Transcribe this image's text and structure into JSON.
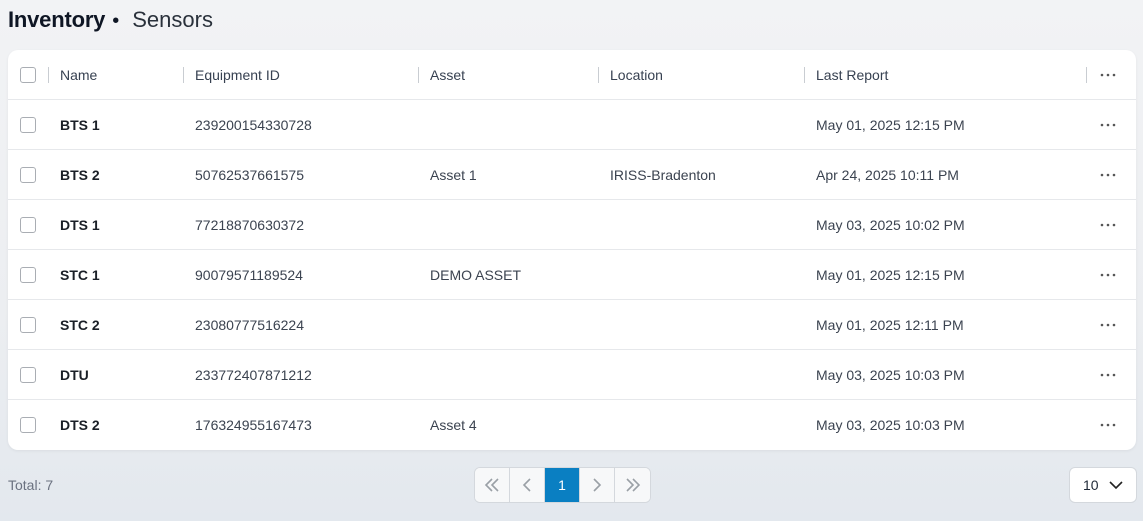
{
  "header": {
    "title": "Inventory",
    "separator": "•",
    "subtitle": "Sensors"
  },
  "table": {
    "columns": [
      "Name",
      "Equipment ID",
      "Asset",
      "Location",
      "Last Report"
    ],
    "rows": [
      {
        "name": "BTS 1",
        "equipment_id": "239200154330728",
        "asset": "",
        "location": "",
        "last_report": "May 01, 2025 12:15 PM"
      },
      {
        "name": "BTS 2",
        "equipment_id": "50762537661575",
        "asset": "Asset 1",
        "location": "IRISS-Bradenton",
        "last_report": "Apr 24, 2025 10:11 PM"
      },
      {
        "name": "DTS 1",
        "equipment_id": "77218870630372",
        "asset": "",
        "location": "",
        "last_report": "May 03, 2025 10:02 PM"
      },
      {
        "name": "STC 1",
        "equipment_id": "90079571189524",
        "asset": "DEMO ASSET",
        "location": "",
        "last_report": "May 01, 2025 12:15 PM"
      },
      {
        "name": "STC 2",
        "equipment_id": "23080777516224",
        "asset": "",
        "location": "",
        "last_report": "May 01, 2025 12:11 PM"
      },
      {
        "name": "DTU",
        "equipment_id": "233772407871212",
        "asset": "",
        "location": "",
        "last_report": "May 03, 2025 10:03 PM"
      },
      {
        "name": "DTS 2",
        "equipment_id": "176324955167473",
        "asset": "Asset 4",
        "location": "",
        "last_report": "May 03, 2025 10:03 PM"
      }
    ]
  },
  "footer": {
    "total": "Total: 7",
    "current_page": "1",
    "page_size": "10"
  },
  "icons": {
    "more": "more-horizontal-icon",
    "first": "chevrons-left-icon",
    "prev": "chevron-left-icon",
    "next": "chevron-right-icon",
    "last": "chevrons-right-icon",
    "dropdown": "chevron-down-icon"
  },
  "colors": {
    "accent": "#0a7fc2",
    "text_primary": "#1a1f27",
    "border": "#e6e8eb"
  }
}
